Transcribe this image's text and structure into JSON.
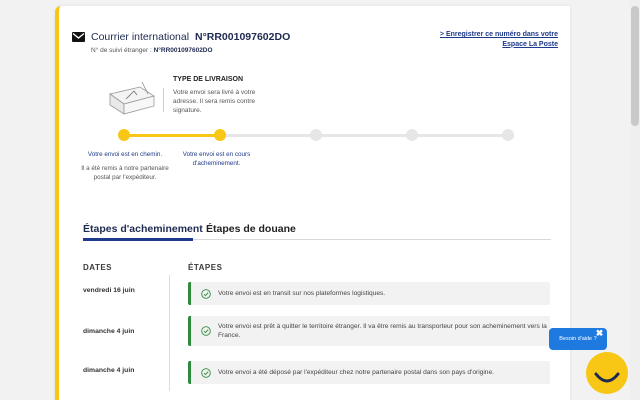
{
  "header": {
    "title_label": "Courrier international",
    "tracking_number": "N°RR001097602DO",
    "subtitle_label": "N° de suivi étranger :",
    "subtitle_number": "N°RR001097602DO",
    "register_link": "> Enregistrer ce numéro dans votre Espace La Poste"
  },
  "delivery": {
    "title": "TYPE DE LIVRAISON",
    "text": "Votre envoi sera livré à votre adresse. Il sera remis contre signature."
  },
  "progress": {
    "step_count": 5,
    "completed_steps": 2,
    "steps": [
      {
        "label": "Votre envoi est en chemin.",
        "note": "Il a été remis à notre partenaire postal par l'expéditeur."
      },
      {
        "label": "Votre envoi est en cours d'acheminement.",
        "note": ""
      }
    ]
  },
  "tabs": [
    {
      "label": "Étapes d'acheminement",
      "active": true
    },
    {
      "label": "Étapes de douane",
      "active": false
    }
  ],
  "history": {
    "dates_header": "DATES",
    "steps_header": "ÉTAPES",
    "events": [
      {
        "date": "vendredi 16 juin",
        "text": "Votre envoi est en transit sur nos plateformes logistiques."
      },
      {
        "date": "dimanche 4 juin",
        "text": "Votre envoi est prêt à quitter le territoire étranger. Il va être remis au transporteur pour son acheminement vers la France."
      },
      {
        "date": "dimanche 4 juin",
        "text": "Votre envoi a été déposé par l'expéditeur chez notre partenaire postal dans son pays d'origine."
      }
    ]
  },
  "help": {
    "label": "Besoin d'aide ?",
    "close": "✖"
  },
  "colors": {
    "accent_yellow": "#f8c614",
    "brand_blue": "#1e3a8a",
    "success_green": "#2e8b3d",
    "help_blue": "#1f7ae0"
  },
  "icons": {
    "header": "envelope-icon",
    "parcel": "parcel-illustration",
    "event": "check-circle-icon",
    "help": "smiley-icon"
  }
}
